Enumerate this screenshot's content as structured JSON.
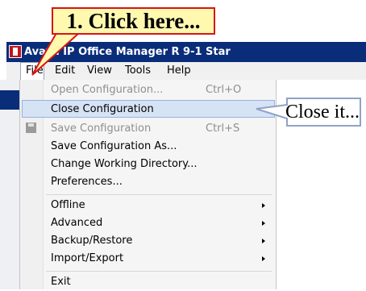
{
  "annotations": {
    "step1": "1. Click here...",
    "close_hint": "Close it..."
  },
  "window": {
    "title": "Avaya IP Office Manager R 9-1  Star"
  },
  "menubar": {
    "file": "File",
    "edit": "Edit",
    "view": "View",
    "tools": "Tools",
    "help": "Help"
  },
  "file_menu": {
    "open": {
      "label": "Open Configuration...",
      "shortcut": "Ctrl+O"
    },
    "close": {
      "label": "Close Configuration"
    },
    "save": {
      "label": "Save Configuration",
      "shortcut": "Ctrl+S"
    },
    "save_as": {
      "label": "Save Configuration As..."
    },
    "change_dir": {
      "label": "Change Working Directory..."
    },
    "preferences": {
      "label": "Preferences..."
    },
    "offline": {
      "label": "Offline"
    },
    "advanced": {
      "label": "Advanced"
    },
    "backup": {
      "label": "Backup/Restore"
    },
    "import_export": {
      "label": "Import/Export"
    },
    "exit": {
      "label": "Exit"
    }
  },
  "colors": {
    "callout_fill": "#fff9b0",
    "callout_border": "#d81515",
    "title_bar": "#0a2d7a",
    "highlight": "#d6e3f5",
    "close_callout_border": "#8fa2c8"
  }
}
